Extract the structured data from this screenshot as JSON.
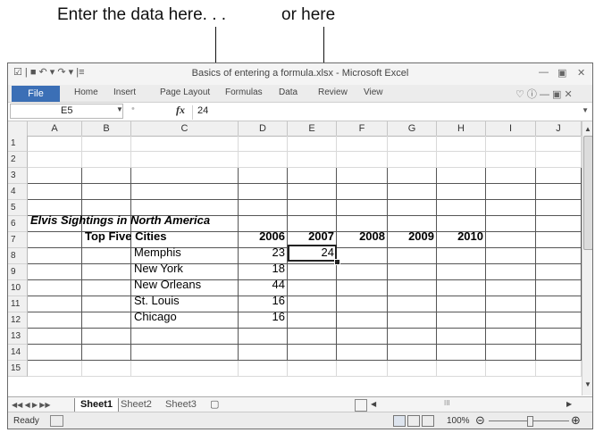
{
  "callouts": {
    "left": "Enter the data here. . .",
    "right": "or here"
  },
  "window": {
    "title": "Basics of entering a formula.xlsx - Microsoft Excel",
    "quick_access": "☑ | ■ ↶ ▾ ↷ ▾ |≡"
  },
  "window_controls": {
    "minimize": "—",
    "restore": "▣",
    "close": "✕"
  },
  "ribbon": {
    "file_tab": "File",
    "tabs": [
      "Home",
      "Insert",
      "Page Layout",
      "Formulas",
      "Data",
      "Review",
      "View"
    ],
    "controls": "♡ ⓘ — ▣ ✕"
  },
  "formula_bar": {
    "name_box": "E5",
    "fx": "fx",
    "formula": "24"
  },
  "columns": [
    "A",
    "B",
    "C",
    "D",
    "E",
    "F",
    "G",
    "H",
    "I",
    "J"
  ],
  "rows": [
    "1",
    "2",
    "3",
    "4",
    "5",
    "6",
    "7",
    "8",
    "9",
    "10",
    "11",
    "12",
    "13",
    "14",
    "15"
  ],
  "sheet": {
    "title": "Elvis Sightings in North America",
    "header_label": "Top Five Cities",
    "years": [
      "2006",
      "2007",
      "2008",
      "2009",
      "2010"
    ],
    "cities": [
      "Memphis",
      "New York",
      "New Orleans",
      "St. Louis",
      "Chicago"
    ],
    "values_2006": [
      "23",
      "18",
      "44",
      "16",
      "16"
    ],
    "value_e5": "24"
  },
  "sheet_tabs": {
    "active": "Sheet1",
    "tabs": [
      "Sheet2",
      "Sheet3"
    ],
    "nav": "◀◀ ◀ ▶ ▶▶"
  },
  "hscroll_mark": "III",
  "status": {
    "ready": "Ready",
    "zoom": "100%"
  }
}
